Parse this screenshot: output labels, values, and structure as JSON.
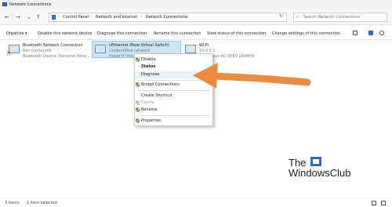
{
  "window": {
    "title": "Network Connections"
  },
  "address": {
    "crumbs": [
      "Control Panel",
      "Network and Internet",
      "Network Connections"
    ],
    "search_placeholder": "Search Network Connections"
  },
  "commands": [
    "Organize",
    "Disable this network device",
    "Diagnose this connection",
    "Rename this connection",
    "View status of this connection",
    "Change settings of this connection"
  ],
  "connections": [
    {
      "name": "Bluetooth Network Connection",
      "status": "Not connected",
      "device": "Bluetooth Device (Personal Area ..."
    },
    {
      "name": "vEthernet (New Virtual Switch)",
      "status": "Unidentified network",
      "device": "Hyper-V Virtu..."
    },
    {
      "name": "Wi-Fi",
      "status": "10.0.0.1",
      "device": "R Wireless-AC 9560 160MHz"
    }
  ],
  "context_menu": {
    "disable": "Disable",
    "status": "Status",
    "diagnose": "Diagnose",
    "bridge": "Bridge Connections",
    "shortcut": "Create Shortcut",
    "delete": "Delete",
    "rename": "Rename",
    "properties": "Properties"
  },
  "statusbar": {
    "count": "3 items",
    "selected": "1 item selected"
  },
  "watermark": {
    "line1": "The",
    "line2": "WindowsClub"
  },
  "colors": {
    "arrow": "#ea8a43",
    "selection": "#cce4f7",
    "accent": "#2f6fb7"
  }
}
